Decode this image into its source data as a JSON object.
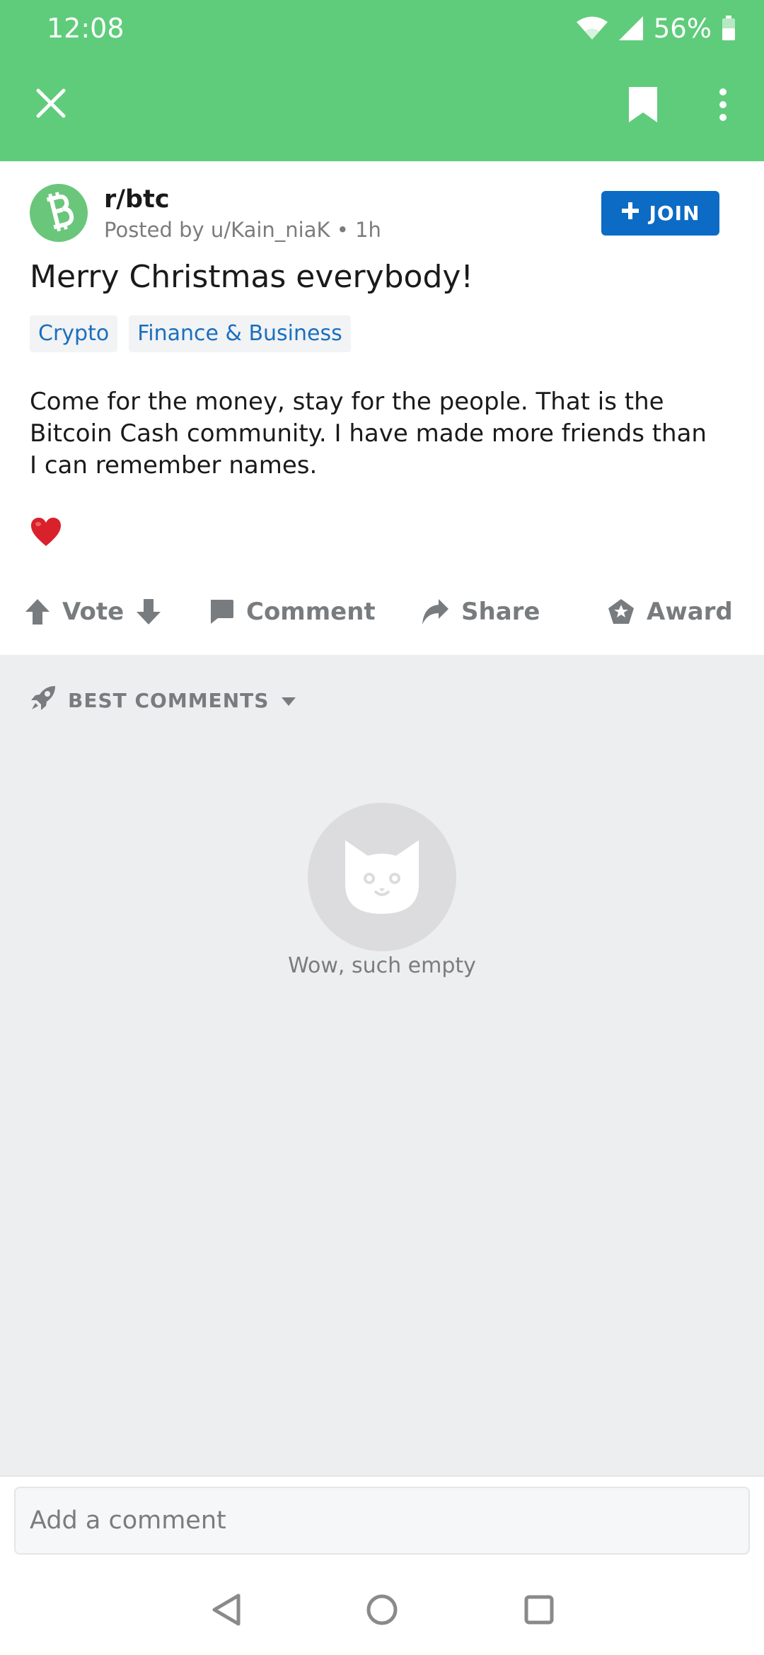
{
  "status_bar": {
    "time": "12:08",
    "battery_percent": "56%"
  },
  "toolbar": {
    "close_icon": "close-icon",
    "bookmark_icon": "bookmark-icon",
    "more_icon": "more-vertical-icon"
  },
  "post": {
    "subreddit": "r/btc",
    "posted_by": "Posted by u/Kain_niaK • 1h",
    "join_label": "JOIN",
    "title": "Merry Christmas everybody!",
    "flairs": [
      "Crypto",
      "Finance & Business"
    ],
    "body_lines": [
      "Come for the money, stay for the people. That is the",
      "Bitcoin Cash community. I have made more friends than",
      "I can remember names."
    ],
    "emoji": "heart-emoji"
  },
  "actions": {
    "vote_label": "Vote",
    "comment_label": "Comment",
    "share_label": "Share",
    "award_label": "Award"
  },
  "comments": {
    "sort_label": "BEST COMMENTS",
    "empty_text": "Wow, such empty"
  },
  "comment_input": {
    "placeholder": "Add a comment"
  },
  "colors": {
    "header_green": "#5fcc7b",
    "join_blue": "#0b6bc5",
    "flair_text": "#1a6fbf",
    "comments_bg": "#edeef0"
  }
}
